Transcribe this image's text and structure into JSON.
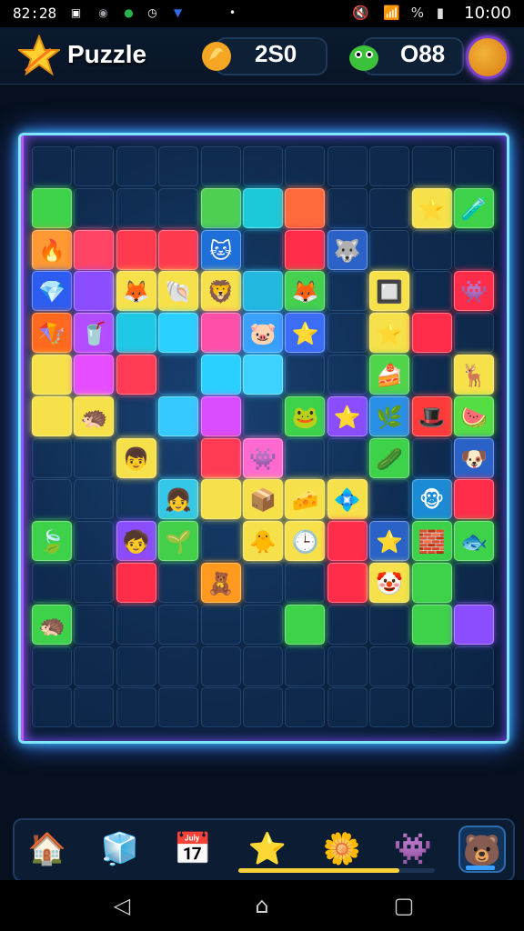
{
  "status_bar": {
    "time_left": "82:28",
    "time_right": "10:00",
    "battery_label": "%",
    "left_icons": [
      {
        "name": "notification-icon",
        "glyph": "▣",
        "color": "#ffffff"
      },
      {
        "name": "app-icon-grey",
        "glyph": "◉",
        "color": "#9aa0a6"
      },
      {
        "name": "app-icon-green",
        "glyph": "●",
        "color": "#27b34a"
      },
      {
        "name": "clock-icon",
        "glyph": "◷",
        "color": "#ffffff"
      },
      {
        "name": "app-icon-blue",
        "glyph": "▼",
        "color": "#2d6cdf"
      },
      {
        "name": "dot-icon",
        "glyph": "•",
        "color": "#ffffff"
      }
    ]
  },
  "header": {
    "title": "Puzzle",
    "coins": "2S0",
    "gems": "O88"
  },
  "board": {
    "cols": 11,
    "rows": 14,
    "tiles": [
      {
        "r": 1,
        "c": 0,
        "color": "#3ed14a",
        "glyph": ""
      },
      {
        "r": 1,
        "c": 4,
        "color": "#4fcf52",
        "glyph": ""
      },
      {
        "r": 1,
        "c": 5,
        "color": "#1bc9d9",
        "glyph": ""
      },
      {
        "r": 1,
        "c": 6,
        "color": "#ff6a3d",
        "glyph": ""
      },
      {
        "r": 1,
        "c": 9,
        "color": "#f7e14a",
        "glyph": "⭐"
      },
      {
        "r": 1,
        "c": 10,
        "color": "#3ed14a",
        "glyph": "🧪"
      },
      {
        "r": 2,
        "c": 0,
        "color": "#ff9933",
        "glyph": "🔥"
      },
      {
        "r": 2,
        "c": 1,
        "color": "#ff4466",
        "glyph": ""
      },
      {
        "r": 2,
        "c": 2,
        "color": "#ff3a4f",
        "glyph": ""
      },
      {
        "r": 2,
        "c": 3,
        "color": "#ff3a4f",
        "glyph": ""
      },
      {
        "r": 2,
        "c": 4,
        "color": "#1f6fd9",
        "glyph": "🐱"
      },
      {
        "r": 2,
        "c": 6,
        "color": "#ff2d4a",
        "glyph": ""
      },
      {
        "r": 2,
        "c": 7,
        "color": "#2a62c8",
        "glyph": "🐺"
      },
      {
        "r": 3,
        "c": 0,
        "color": "#2d5df0",
        "glyph": "💎"
      },
      {
        "r": 3,
        "c": 1,
        "color": "#8a4dff",
        "glyph": ""
      },
      {
        "r": 3,
        "c": 2,
        "color": "#f7e14a",
        "glyph": "🦊"
      },
      {
        "r": 3,
        "c": 3,
        "color": "#f7e14a",
        "glyph": "🐚"
      },
      {
        "r": 3,
        "c": 4,
        "color": "#f7e14a",
        "glyph": "🦁"
      },
      {
        "r": 3,
        "c": 5,
        "color": "#22b8e0",
        "glyph": ""
      },
      {
        "r": 3,
        "c": 6,
        "color": "#45d04f",
        "glyph": "🦊"
      },
      {
        "r": 3,
        "c": 8,
        "color": "#f7e14a",
        "glyph": "🔲"
      },
      {
        "r": 3,
        "c": 10,
        "color": "#ff2d4a",
        "glyph": "👾"
      },
      {
        "r": 4,
        "c": 0,
        "color": "#ff6a1e",
        "glyph": "🪁"
      },
      {
        "r": 4,
        "c": 1,
        "color": "#b34dff",
        "glyph": "🥤"
      },
      {
        "r": 4,
        "c": 2,
        "color": "#1ec9e6",
        "glyph": ""
      },
      {
        "r": 4,
        "c": 3,
        "color": "#2ad0ff",
        "glyph": ""
      },
      {
        "r": 4,
        "c": 4,
        "color": "#ff4fa8",
        "glyph": ""
      },
      {
        "r": 4,
        "c": 5,
        "color": "#3aa0ff",
        "glyph": "🐷"
      },
      {
        "r": 4,
        "c": 6,
        "color": "#3b6df7",
        "glyph": "⭐"
      },
      {
        "r": 4,
        "c": 8,
        "color": "#f7e14a",
        "glyph": "⭐"
      },
      {
        "r": 4,
        "c": 9,
        "color": "#ff2d4a",
        "glyph": ""
      },
      {
        "r": 5,
        "c": 0,
        "color": "#f7e14a",
        "glyph": ""
      },
      {
        "r": 5,
        "c": 1,
        "color": "#e64dff",
        "glyph": ""
      },
      {
        "r": 5,
        "c": 2,
        "color": "#ff3a55",
        "glyph": ""
      },
      {
        "r": 5,
        "c": 4,
        "color": "#2ad0ff",
        "glyph": ""
      },
      {
        "r": 5,
        "c": 5,
        "color": "#3dd1ff",
        "glyph": ""
      },
      {
        "r": 5,
        "c": 8,
        "color": "#4fd44a",
        "glyph": "🍰"
      },
      {
        "r": 5,
        "c": 10,
        "color": "#f7e14a",
        "glyph": "🦌"
      },
      {
        "r": 6,
        "c": 0,
        "color": "#f7e14a",
        "glyph": ""
      },
      {
        "r": 6,
        "c": 1,
        "color": "#f7e14a",
        "glyph": "🦔"
      },
      {
        "r": 6,
        "c": 3,
        "color": "#35c9ff",
        "glyph": ""
      },
      {
        "r": 6,
        "c": 4,
        "color": "#d94dff",
        "glyph": ""
      },
      {
        "r": 6,
        "c": 6,
        "color": "#3ed14a",
        "glyph": "🐸"
      },
      {
        "r": 6,
        "c": 7,
        "color": "#8a4dff",
        "glyph": "⭐"
      },
      {
        "r": 6,
        "c": 8,
        "color": "#2a8fe6",
        "glyph": "🌿"
      },
      {
        "r": 6,
        "c": 9,
        "color": "#ff3a3a",
        "glyph": "🎩"
      },
      {
        "r": 6,
        "c": 10,
        "color": "#55dd44",
        "glyph": "🍉"
      },
      {
        "r": 7,
        "c": 2,
        "color": "#f7e14a",
        "glyph": "👦"
      },
      {
        "r": 7,
        "c": 4,
        "color": "#ff3a55",
        "glyph": ""
      },
      {
        "r": 7,
        "c": 5,
        "color": "#ff6ad0",
        "glyph": "👾"
      },
      {
        "r": 7,
        "c": 8,
        "color": "#3ed14a",
        "glyph": "🥒"
      },
      {
        "r": 7,
        "c": 10,
        "color": "#2a62c8",
        "glyph": "🐶"
      },
      {
        "r": 8,
        "c": 3,
        "color": "#34c7e8",
        "glyph": "👧"
      },
      {
        "r": 8,
        "c": 4,
        "color": "#f7e14a",
        "glyph": ""
      },
      {
        "r": 8,
        "c": 5,
        "color": "#f7e14a",
        "glyph": "📦"
      },
      {
        "r": 8,
        "c": 6,
        "color": "#f7e14a",
        "glyph": "🧀"
      },
      {
        "r": 8,
        "c": 7,
        "color": "#f7e14a",
        "glyph": "💠"
      },
      {
        "r": 8,
        "c": 9,
        "color": "#1b8bd6",
        "glyph": "🐵"
      },
      {
        "r": 8,
        "c": 10,
        "color": "#ff2d4a",
        "glyph": ""
      },
      {
        "r": 9,
        "c": 0,
        "color": "#3ed14a",
        "glyph": "🍃"
      },
      {
        "r": 9,
        "c": 2,
        "color": "#8a4dff",
        "glyph": "🧒"
      },
      {
        "r": 9,
        "c": 3,
        "color": "#43cf4a",
        "glyph": "🌱"
      },
      {
        "r": 9,
        "c": 5,
        "color": "#f7e14a",
        "glyph": "🐥"
      },
      {
        "r": 9,
        "c": 6,
        "color": "#f7e14a",
        "glyph": "🕒"
      },
      {
        "r": 9,
        "c": 7,
        "color": "#ff2d4a",
        "glyph": ""
      },
      {
        "r": 9,
        "c": 8,
        "color": "#2a62c8",
        "glyph": "⭐"
      },
      {
        "r": 9,
        "c": 9,
        "color": "#3ed14a",
        "glyph": "🧱"
      },
      {
        "r": 9,
        "c": 10,
        "color": "#3ed14a",
        "glyph": "🐟"
      },
      {
        "r": 10,
        "c": 2,
        "color": "#ff2d4a",
        "glyph": ""
      },
      {
        "r": 10,
        "c": 4,
        "color": "#ff9a1e",
        "glyph": "🧸"
      },
      {
        "r": 10,
        "c": 7,
        "color": "#ff2d4a",
        "glyph": ""
      },
      {
        "r": 10,
        "c": 8,
        "color": "#f7e14a",
        "glyph": "🤡"
      },
      {
        "r": 10,
        "c": 9,
        "color": "#3ed14a",
        "glyph": ""
      },
      {
        "r": 11,
        "c": 0,
        "color": "#3ed14a",
        "glyph": "🦔"
      },
      {
        "r": 11,
        "c": 6,
        "color": "#3ed14a",
        "glyph": ""
      },
      {
        "r": 11,
        "c": 9,
        "color": "#3ed14a",
        "glyph": ""
      },
      {
        "r": 11,
        "c": 10,
        "color": "#8a4dff",
        "glyph": ""
      }
    ]
  },
  "bottom_nav": {
    "progress": 0.82,
    "items": [
      {
        "name": "home-icon",
        "glyph": "🏠",
        "active": false
      },
      {
        "name": "blue-block-icon",
        "glyph": "🧊",
        "active": false
      },
      {
        "name": "calendar-icon",
        "glyph": "📅",
        "active": false
      },
      {
        "name": "star-character-icon",
        "glyph": "⭐",
        "active": false
      },
      {
        "name": "gear-flower-icon",
        "glyph": "🌼",
        "active": false
      },
      {
        "name": "purple-monster-icon",
        "glyph": "👾",
        "active": false
      },
      {
        "name": "bear-icon",
        "glyph": "🐻",
        "active": true
      }
    ]
  },
  "colors": {
    "accent_cyan": "#7ee7ff",
    "accent_purple": "#c255ff",
    "progress_yellow": "#f7d23b"
  }
}
